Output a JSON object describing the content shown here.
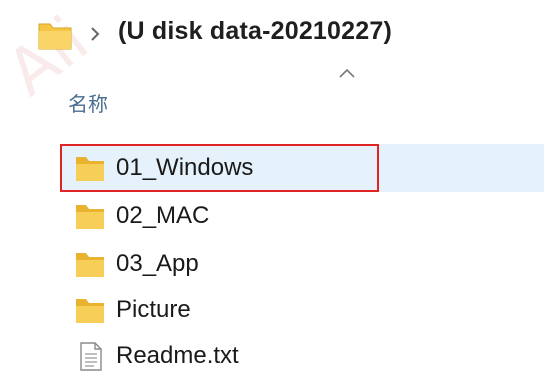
{
  "addressbar": {
    "path": "(U disk data-20210227)",
    "folder_icon": "folder-icon",
    "separator_icon": "chevron-right-icon"
  },
  "header": {
    "sort_icon": "sort-ascending-icon",
    "name_column": "名称"
  },
  "watermark": {
    "text": "AliExpress.ru"
  },
  "files": [
    {
      "name": "01_Windows",
      "type": "folder",
      "icon": "folder-icon",
      "selected": true
    },
    {
      "name": "02_MAC",
      "type": "folder",
      "icon": "folder-icon",
      "selected": false
    },
    {
      "name": "03_App",
      "type": "folder",
      "icon": "folder-icon",
      "selected": false
    },
    {
      "name": "Picture",
      "type": "folder",
      "icon": "folder-icon",
      "selected": false
    },
    {
      "name": "Readme.txt",
      "type": "text-file",
      "icon": "text-file-icon",
      "selected": false
    }
  ],
  "colors": {
    "folder_yellow": "#f5c543",
    "selection_bg": "#e5f1fb",
    "highlight_border": "#e02424",
    "header_text": "#4b6e8f"
  }
}
